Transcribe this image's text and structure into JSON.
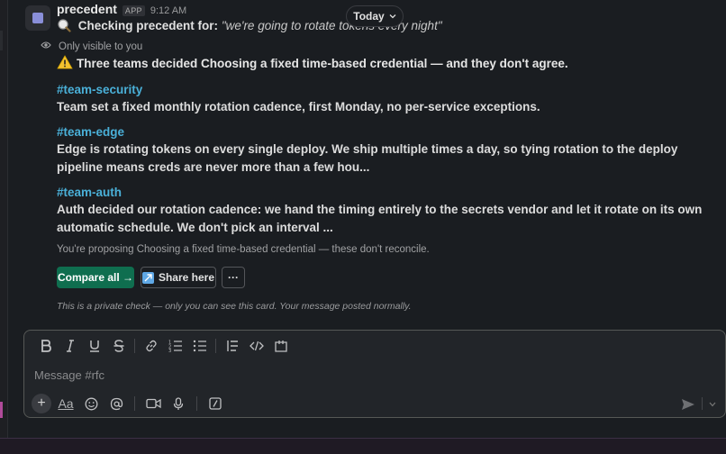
{
  "message": {
    "bot_name": "precedent",
    "app_badge": "APP",
    "time": "9:12 AM",
    "checking_label": "Checking precedent for:",
    "checking_query": "\"we're going to rotate tokens every night\"",
    "visibility": "Only visible to you",
    "warning": "Three teams decided Choosing a fixed time-based credential — and they don't agree.",
    "decisions": [
      {
        "channel": "#team-security",
        "text": "Team set a fixed monthly rotation cadence, first Monday, no per-service exceptions."
      },
      {
        "channel": "#team-edge",
        "text": "Edge is rotating tokens on every single deploy. We ship multiple times a day, so tying rotation to the deploy pipeline means creds are never more than a few hou..."
      },
      {
        "channel": "#team-auth",
        "text": "Auth decided our rotation cadence: we hand the timing entirely to the secrets vendor and let it rotate on its own automatic schedule. We don't pick an interval ..."
      }
    ],
    "proposing": "You're proposing Choosing a fixed time-based credential — these don't reconcile.",
    "actions": {
      "compare": "Compare all →",
      "share": "Share here",
      "more": "···"
    },
    "footnote": "This is a private check — only you can see this card. Your message posted normally."
  },
  "date_pill": {
    "label": "Today"
  },
  "composer": {
    "placeholder": "Message #rfc",
    "value": "",
    "format_label": "Aa"
  },
  "colors": {
    "accent_channel": "#4ab0d8",
    "primary_button": "#0f6e4f",
    "background": "#1a1d21"
  }
}
